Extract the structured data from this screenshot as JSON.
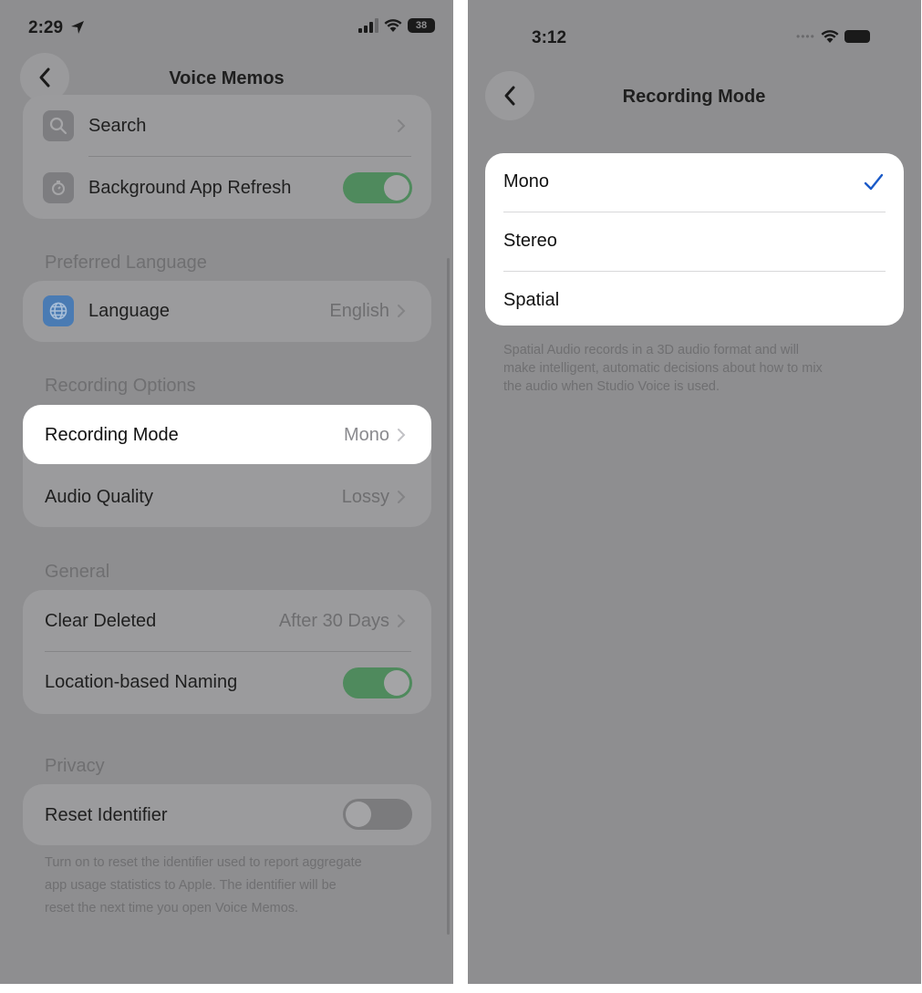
{
  "left": {
    "status": {
      "time": "2:29",
      "battery": "38"
    },
    "nav": {
      "title": "Voice Memos"
    },
    "group1": {
      "search": {
        "label": "Search"
      },
      "background_refresh": {
        "label": "Background App Refresh",
        "on": true
      }
    },
    "preferred_language": {
      "header": "Preferred Language",
      "language": {
        "label": "Language",
        "value": "English"
      }
    },
    "recording_options": {
      "header": "Recording Options",
      "recording_mode": {
        "label": "Recording Mode",
        "value": "Mono"
      },
      "audio_quality": {
        "label": "Audio Quality",
        "value": "Lossy"
      }
    },
    "general": {
      "header": "General",
      "clear_deleted": {
        "label": "Clear Deleted",
        "value": "After 30 Days"
      },
      "location_naming": {
        "label": "Location-based Naming",
        "on": true
      }
    },
    "privacy": {
      "header": "Privacy",
      "reset_identifier": {
        "label": "Reset Identifier",
        "on": false
      },
      "footer_line1": "Turn on to reset the identifier used to report aggregate",
      "footer_line2": "app usage statistics to Apple. The identifier will be",
      "footer_line3": "reset the next time you open Voice Memos."
    }
  },
  "right": {
    "status": {
      "time": "3:12"
    },
    "nav": {
      "title": "Recording Mode"
    },
    "options": [
      {
        "label": "Mono",
        "selected": true
      },
      {
        "label": "Stereo",
        "selected": false
      },
      {
        "label": "Spatial",
        "selected": false
      }
    ],
    "footer_line1": "Spatial Audio records in a 3D audio format and will",
    "footer_line2": "make intelligent, automatic decisions about how to mix",
    "footer_line3": "the audio when Studio Voice is used."
  },
  "colors": {
    "dim_overlay": "#8e8e90",
    "toggle_on": "#4f8a5d",
    "toggle_off": "#7b7b7d",
    "checkmark": "#1a5ac8"
  }
}
